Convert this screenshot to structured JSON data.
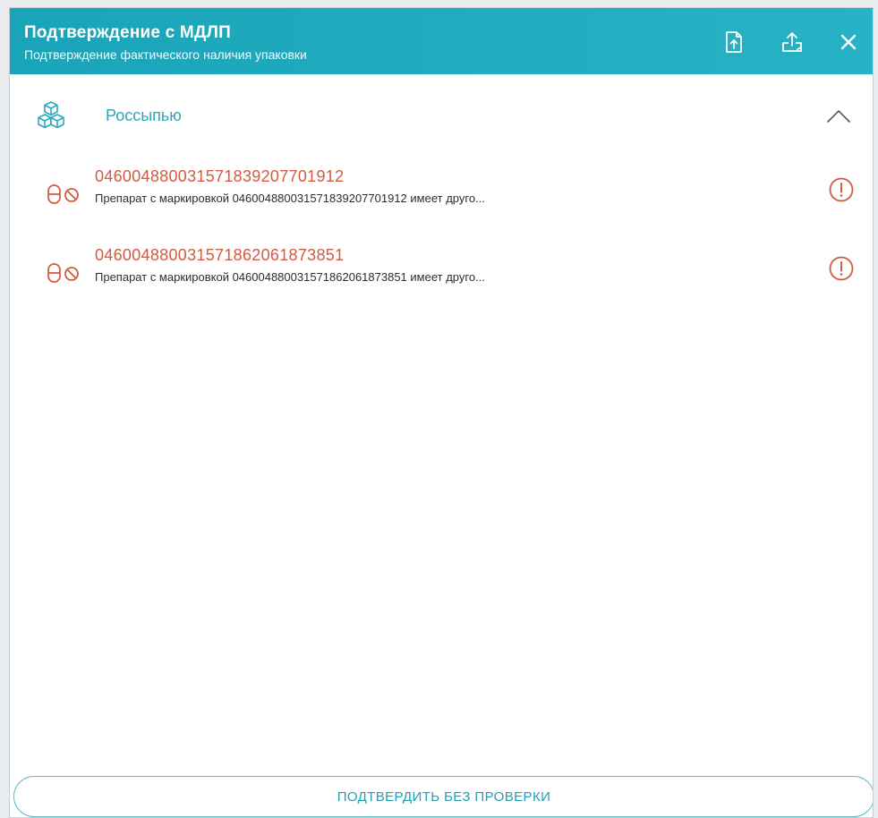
{
  "header": {
    "title": "Подтверждение с МДЛП",
    "subtitle": "Подтверждение фактического наличия упаковки",
    "actions": [
      {
        "name": "import-file-icon"
      },
      {
        "name": "upload-icon"
      },
      {
        "name": "close-icon"
      }
    ]
  },
  "group": {
    "label": "Россыпью",
    "icon": "boxes-icon",
    "expanded": true
  },
  "items": [
    {
      "code": "04600488003157183920770191​2",
      "description": "Препарат с маркировкой 04600488003157183920770191​2 имеет друго...",
      "status": "warning"
    },
    {
      "code": "046004880031571862061873851",
      "description": "Препарат с маркировкой 046004880031571862061873851 имеет друго...",
      "status": "warning"
    }
  ],
  "footer": {
    "confirm_label": "ПОДТВЕРДИТЬ БЕЗ ПРОВЕРКИ"
  },
  "colors": {
    "header": "#1aa4b9",
    "accent": "#2ba8ba",
    "error": "#d45a40"
  }
}
